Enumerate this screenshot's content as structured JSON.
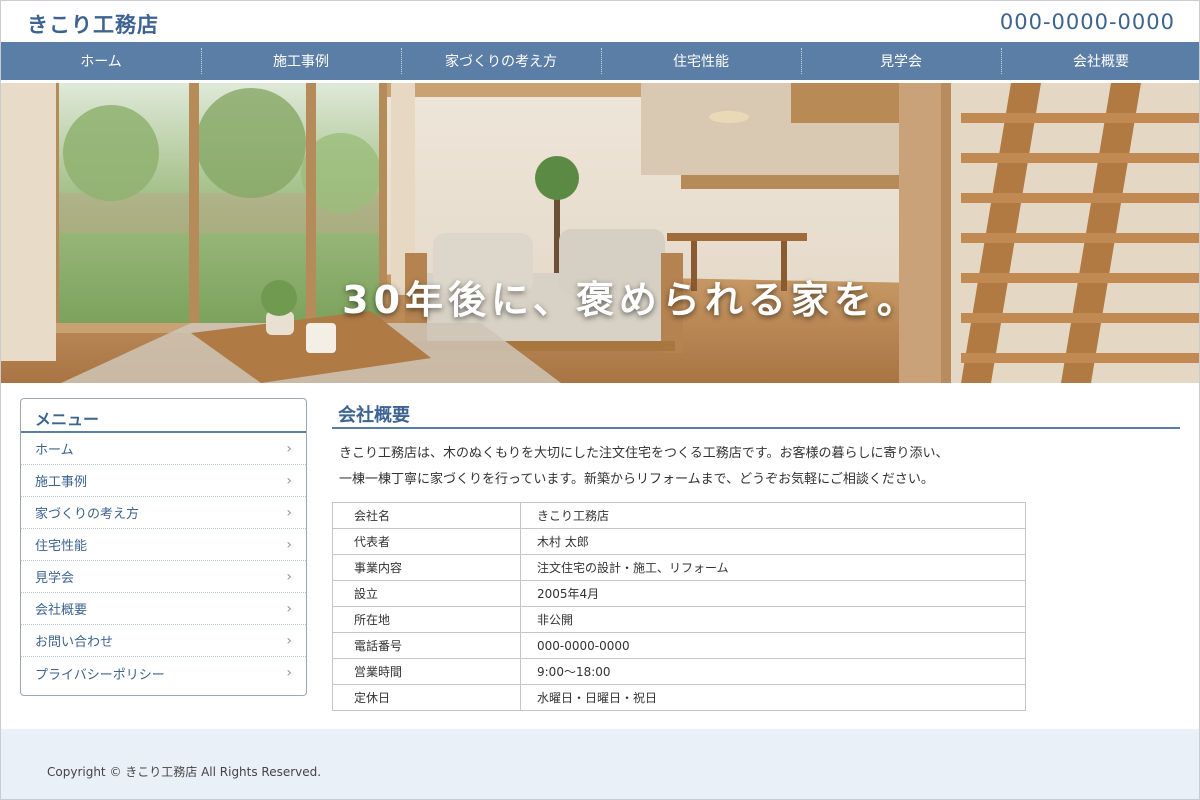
{
  "header": {
    "logo": "きこり工務店",
    "phone": "000-0000-0000"
  },
  "nav": [
    {
      "label": "ホーム"
    },
    {
      "label": "施工事例"
    },
    {
      "label": "家づくりの考え方"
    },
    {
      "label": "住宅性能"
    },
    {
      "label": "見学会"
    },
    {
      "label": "会社概要"
    }
  ],
  "hero": {
    "catchcopy": "30年後に、褒められる家を。"
  },
  "sidebar": {
    "title": "メニュー",
    "chevron": "›",
    "items": [
      {
        "label": "ホーム"
      },
      {
        "label": "施工事例"
      },
      {
        "label": "家づくりの考え方"
      },
      {
        "label": "住宅性能"
      },
      {
        "label": "見学会"
      },
      {
        "label": "会社概要"
      },
      {
        "label": "お問い合わせ"
      },
      {
        "label": "プライバシーポリシー"
      }
    ]
  },
  "main": {
    "title": "会社概要",
    "intro_lines": [
      "きこり工務店は、木のぬくもりを大切にした注文住宅をつくる工務店です。お客様の暮らしに寄り添い、",
      "一棟一棟丁寧に家づくりを行っています。新築からリフォームまで、どうぞお気軽にご相談ください。"
    ],
    "table": [
      {
        "key": "会社名",
        "value": "きこり工務店"
      },
      {
        "key": "代表者",
        "value": "木村 太郎"
      },
      {
        "key": "事業内容",
        "value": "注文住宅の設計・施工、リフォーム"
      },
      {
        "key": "設立",
        "value": "2005年4月"
      },
      {
        "key": "所在地",
        "value": "非公開"
      },
      {
        "key": "電話番号",
        "value": "000-0000-0000"
      },
      {
        "key": "営業時間",
        "value": "9:00〜18:00"
      },
      {
        "key": "定休日",
        "value": "水曜日・日曜日・祝日"
      }
    ]
  },
  "footer": {
    "copyright": "Copyright © きこり工務店 All Rights Reserved."
  },
  "colors": {
    "brand": "#3d6391",
    "nav_bg": "#5b7ea6",
    "footer_bg": "#eaf0f7"
  }
}
